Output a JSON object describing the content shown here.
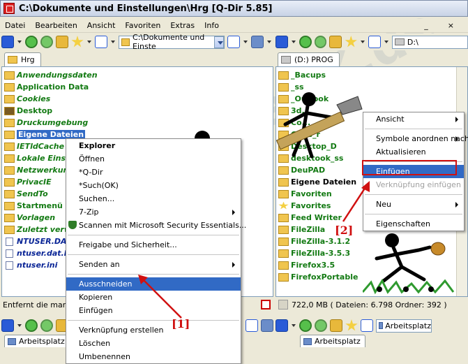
{
  "window": {
    "title": "C:\\Dokumente und Einstellungen\\Hrg  [Q-Dir 5.85]"
  },
  "menu": [
    "Datei",
    "Bearbeiten",
    "Ansicht",
    "Favoriten",
    "Extras",
    "Info"
  ],
  "left_pane": {
    "path": "C:\\Dokumente und Einste",
    "tab": "Hrg",
    "files": [
      {
        "name": "Anwendungsdaten",
        "style": "ital",
        "icon": "folder"
      },
      {
        "name": "Application Data",
        "style": "plain",
        "icon": "folder"
      },
      {
        "name": "Cookies",
        "style": "ital",
        "icon": "folder"
      },
      {
        "name": "Desktop",
        "style": "plain",
        "icon": "folder-dark"
      },
      {
        "name": "Druckumgebung",
        "style": "ital",
        "icon": "folder"
      },
      {
        "name": "Eigene Dateien",
        "style": "sel",
        "icon": "folder"
      },
      {
        "name": "IETldCache",
        "style": "ital",
        "icon": "folder"
      },
      {
        "name": "Lokale Einste",
        "style": "ital",
        "icon": "folder"
      },
      {
        "name": "Netzwerkum",
        "style": "ital",
        "icon": "folder"
      },
      {
        "name": "PrivacIE",
        "style": "ital",
        "icon": "folder"
      },
      {
        "name": "SendTo",
        "style": "ital",
        "icon": "folder"
      },
      {
        "name": "Startmenü",
        "style": "plain",
        "icon": "folder"
      },
      {
        "name": "Vorlagen",
        "style": "ital",
        "icon": "folder"
      },
      {
        "name": "Zuletzt verw",
        "style": "ital",
        "icon": "folder"
      },
      {
        "name": "NTUSER.DAT",
        "style": "blue",
        "icon": "doc"
      },
      {
        "name": "ntuser.dat.L",
        "style": "blue",
        "icon": "doc"
      },
      {
        "name": "ntuser.ini",
        "style": "blue",
        "icon": "doc"
      }
    ],
    "status": "Entfernt die markie"
  },
  "right_pane": {
    "path": "D:\\",
    "tab": "(D:) PROG",
    "files": [
      {
        "name": "_Bacups",
        "style": "plain",
        "icon": "folder"
      },
      {
        "name": "_ss",
        "style": "plain",
        "icon": "folder"
      },
      {
        "name": "_Outlook",
        "style": "plain",
        "icon": "folder"
      },
      {
        "name": "3d...",
        "style": "plain",
        "icon": "folder"
      },
      {
        "name": "Co...",
        "style": "plain",
        "icon": "folder"
      },
      {
        "name": "Code_r",
        "style": "plain",
        "icon": "folder"
      },
      {
        "name": "Desktop_D",
        "style": "plain",
        "icon": "folder"
      },
      {
        "name": "desktook_ss",
        "style": "plain",
        "icon": "folder"
      },
      {
        "name": "DeuPAD",
        "style": "plain",
        "icon": "folder"
      },
      {
        "name": "Eigene Dateien",
        "style": "black",
        "icon": "folder"
      },
      {
        "name": "Favoriten",
        "style": "plain",
        "icon": "folder"
      },
      {
        "name": "Favorites",
        "style": "plain",
        "icon": "star"
      },
      {
        "name": "Feed Writer",
        "style": "plain",
        "icon": "folder"
      },
      {
        "name": "FileZilla",
        "style": "plain",
        "icon": "folder"
      },
      {
        "name": "FileZilla-3.1.2",
        "style": "plain",
        "icon": "folder"
      },
      {
        "name": "FileZilla-3.5.3",
        "style": "plain",
        "icon": "folder"
      },
      {
        "name": "Firefox3.5",
        "style": "plain",
        "icon": "folder"
      },
      {
        "name": "FirefoxPortable",
        "style": "plain",
        "icon": "folder"
      }
    ],
    "status": "722,0 MB ( Dateien: 6.798 Ordner: 392 )"
  },
  "context_menu_left": {
    "items": [
      {
        "label": "Explorer",
        "type": "bold"
      },
      {
        "label": "Öffnen",
        "type": "normal"
      },
      {
        "label": "*Q-Dir",
        "type": "normal"
      },
      {
        "label": "*Such(OK)",
        "type": "normal"
      },
      {
        "label": "Suchen...",
        "type": "normal"
      },
      {
        "label": "7-Zip",
        "type": "sub"
      },
      {
        "label": "Scannen mit Microsoft Security Essentials...",
        "type": "shield"
      },
      {
        "label": "",
        "type": "sep"
      },
      {
        "label": "Freigabe und Sicherheit...",
        "type": "normal"
      },
      {
        "label": "",
        "type": "sep"
      },
      {
        "label": "Senden an",
        "type": "sub"
      },
      {
        "label": "",
        "type": "sep"
      },
      {
        "label": "Ausschneiden",
        "type": "hl"
      },
      {
        "label": "Kopieren",
        "type": "normal"
      },
      {
        "label": "Einfügen",
        "type": "normal"
      },
      {
        "label": "",
        "type": "sep"
      },
      {
        "label": "Verknüpfung erstellen",
        "type": "normal"
      },
      {
        "label": "Löschen",
        "type": "normal"
      },
      {
        "label": "Umbenennen",
        "type": "normal"
      }
    ]
  },
  "context_menu_right": {
    "items": [
      {
        "label": "Ansicht",
        "type": "sub"
      },
      {
        "label": "",
        "type": "sep"
      },
      {
        "label": "Symbole anordnen nach",
        "type": "sub"
      },
      {
        "label": "Aktualisieren",
        "type": "normal"
      },
      {
        "label": "",
        "type": "sep"
      },
      {
        "label": "Einfügen",
        "type": "hl"
      },
      {
        "label": "Verknüpfung einfügen",
        "type": "dis"
      },
      {
        "label": "",
        "type": "sep"
      },
      {
        "label": "Neu",
        "type": "sub"
      },
      {
        "label": "",
        "type": "sep"
      },
      {
        "label": "Eigenschaften",
        "type": "normal"
      }
    ]
  },
  "bottom": {
    "left_tab": "Arbeitsplatz",
    "right_tab": "Arbeitsplatz",
    "right_path": "Arbeitsplatz"
  },
  "callouts": {
    "one": "[1]",
    "two": "[2]"
  },
  "watermark": "SoftwareOK.de",
  "colors": {
    "selection": "#316ac5",
    "folder_text": "#137a13",
    "callout": "#d01010"
  }
}
